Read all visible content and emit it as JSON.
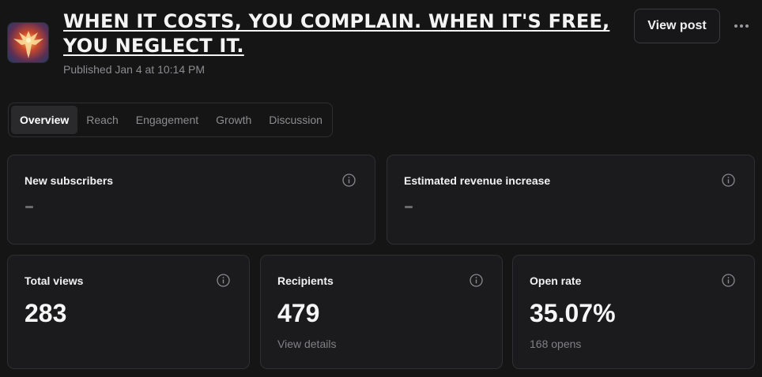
{
  "post": {
    "title": "WHEN IT COSTS, YOU COMPLAIN. WHEN IT'S FREE, YOU NEGLECT IT.",
    "published": "Published Jan 4 at 10:14 PM",
    "view_post_label": "View post",
    "thumbnail_icon": "phoenix-icon"
  },
  "tabs": [
    {
      "label": "Overview",
      "active": true
    },
    {
      "label": "Reach",
      "active": false
    },
    {
      "label": "Engagement",
      "active": false
    },
    {
      "label": "Growth",
      "active": false
    },
    {
      "label": "Discussion",
      "active": false
    }
  ],
  "cards": {
    "new_subscribers": {
      "label": "New subscribers",
      "value": "-"
    },
    "estimated_revenue": {
      "label": "Estimated revenue increase",
      "value": "-"
    },
    "total_views": {
      "label": "Total views",
      "value": "283"
    },
    "recipients": {
      "label": "Recipients",
      "value": "479",
      "sub": "View details"
    },
    "open_rate": {
      "label": "Open rate",
      "value": "35.07%",
      "sub": "168 opens"
    }
  },
  "colors": {
    "background": "#151516",
    "card": "#1b1b1d",
    "border": "#2f2f33",
    "muted_text": "#8c8c90"
  }
}
